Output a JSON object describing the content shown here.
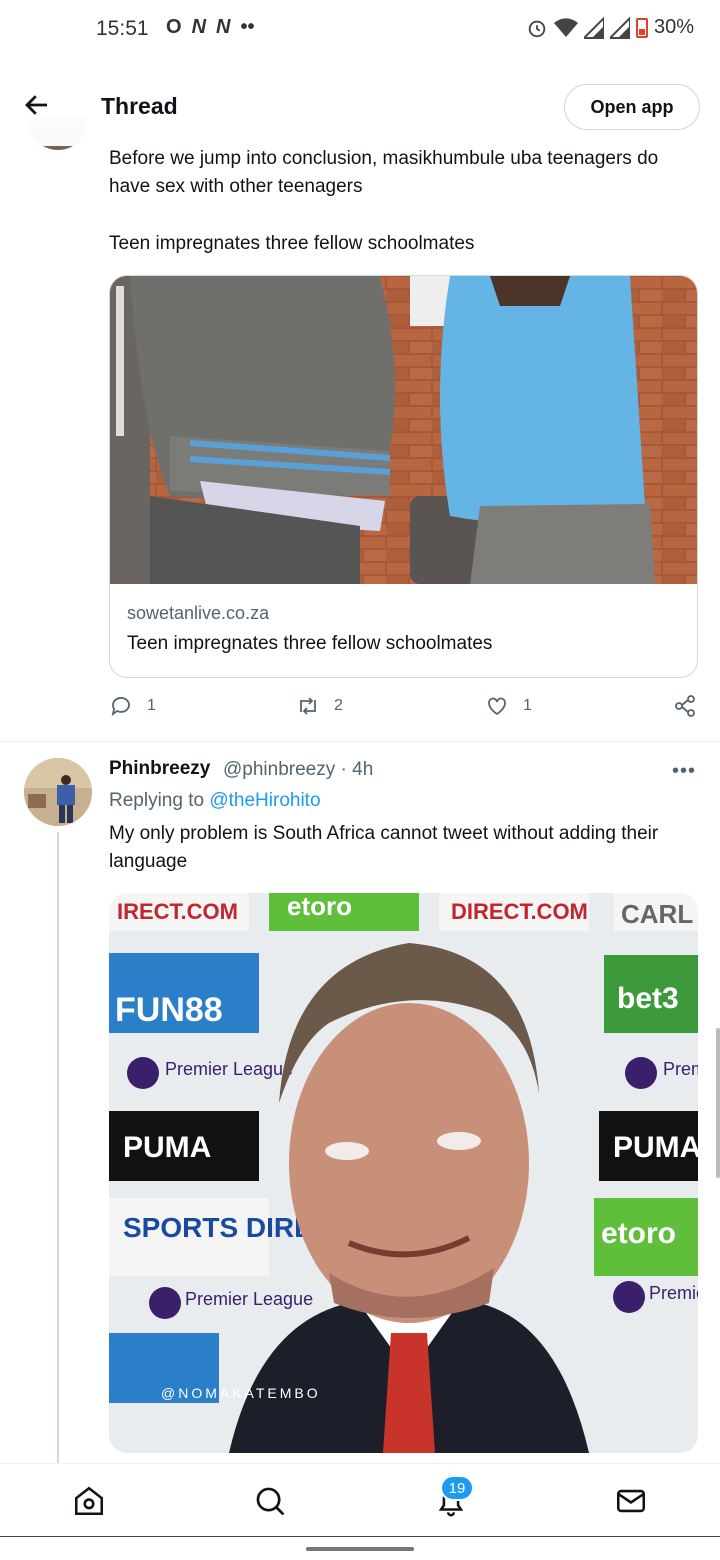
{
  "status_bar": {
    "time": "15:51",
    "notification_icons": [
      "O",
      "N",
      "N",
      "••"
    ],
    "battery": "30%"
  },
  "header": {
    "title": "Thread",
    "open_app_label": "Open app"
  },
  "tweet1": {
    "text_line1": "Before we jump into conclusion, masikhumbule uba teenagers do have sex with other teenagers",
    "text_line2": "Teen impregnates three fellow schoolmates",
    "card": {
      "domain": "sowetanlive.co.za",
      "title": "Teen impregnates three fellow schoolmates"
    },
    "actions": {
      "replies": "1",
      "retweets": "2",
      "likes": "1"
    }
  },
  "tweet2": {
    "display_name": "Phinbreezy",
    "handle_time": "@phinbreezy · 4h",
    "replying_prefix": "Replying to",
    "replying_to": "@theHirohito",
    "text": "My only problem is South Africa cannot tweet without adding their language",
    "image_watermark": "@NOMAKATEMBO",
    "board_texts": [
      "IRECT.COM",
      "etoro",
      "DIRECT.COM",
      "CARL",
      "FUN88",
      "bet3",
      "Premier League",
      "Premier League",
      "PUMA",
      "PUMA",
      "SPORTS DIRECT.COM",
      "etoro",
      "Premier League",
      "Premier League"
    ]
  },
  "bottom_nav": {
    "notifications_badge": "19"
  }
}
